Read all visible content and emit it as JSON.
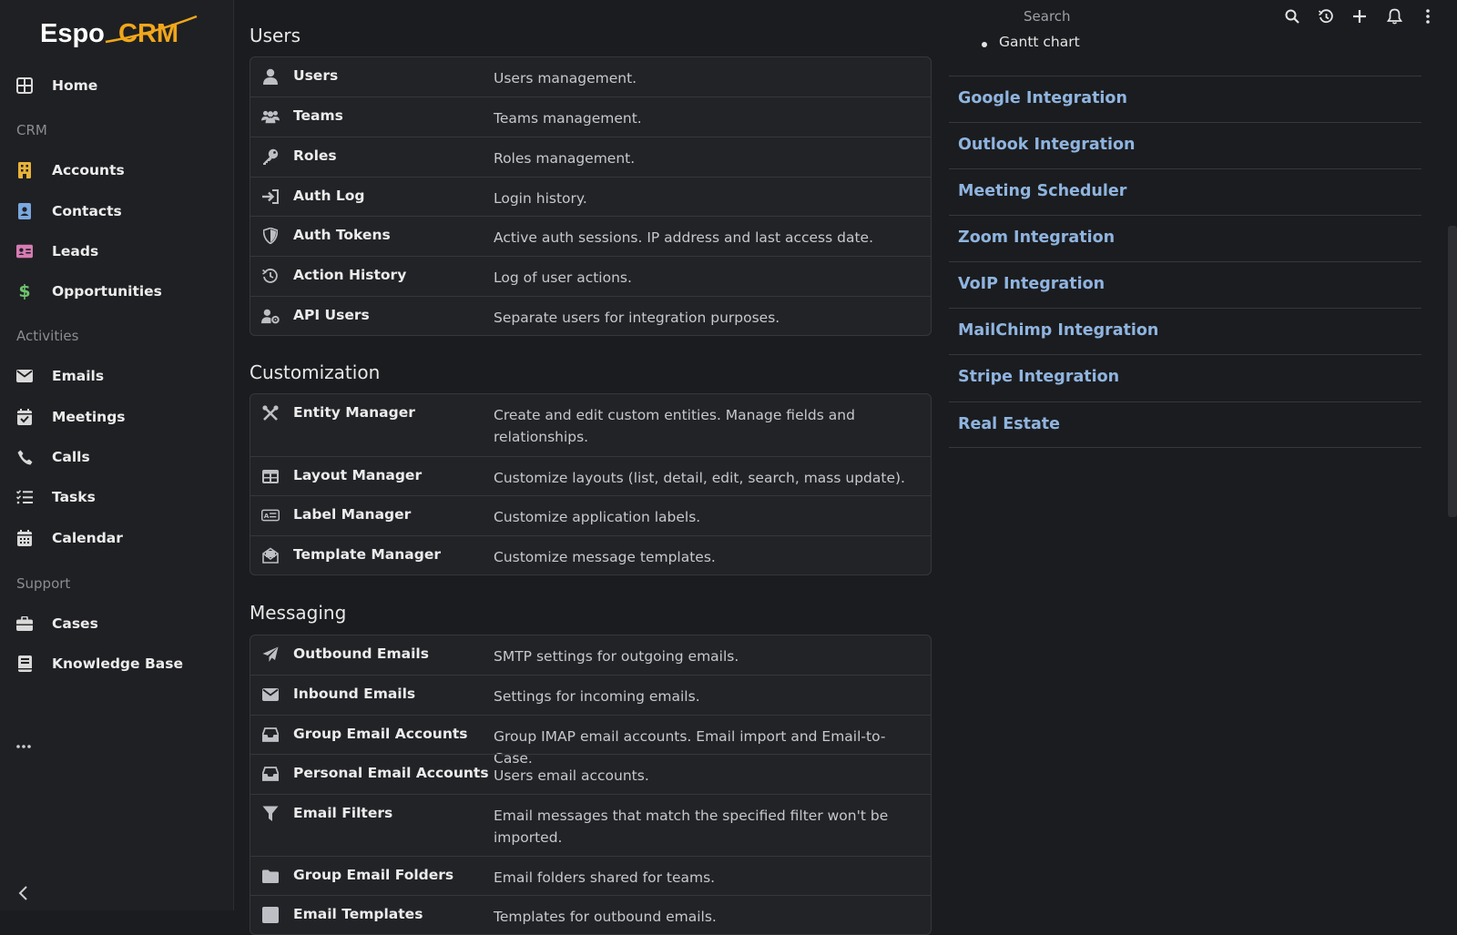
{
  "app": {
    "logo_text_espo": "Espo",
    "logo_text_crm": "CRM"
  },
  "sidebar": {
    "items": [
      {
        "label": "Home",
        "icon": "home-icon"
      },
      {
        "label": "Accounts",
        "icon": "building-icon",
        "color": "#e8b338"
      },
      {
        "label": "Contacts",
        "icon": "contact-card-icon",
        "color": "#7aa7e0"
      },
      {
        "label": "Leads",
        "icon": "id-card-icon",
        "color": "#d77bb4"
      },
      {
        "label": "Opportunities",
        "icon": "dollar-icon",
        "color": "#6dc46d"
      },
      {
        "label": "Emails",
        "icon": "envelope-icon"
      },
      {
        "label": "Meetings",
        "icon": "calendar-check-icon"
      },
      {
        "label": "Calls",
        "icon": "phone-icon"
      },
      {
        "label": "Tasks",
        "icon": "tasks-icon"
      },
      {
        "label": "Calendar",
        "icon": "calendar-icon"
      },
      {
        "label": "Cases",
        "icon": "briefcase-icon"
      },
      {
        "label": "Knowledge Base",
        "icon": "book-icon"
      }
    ],
    "sections": {
      "crm": "CRM",
      "activities": "Activities",
      "support": "Support"
    }
  },
  "topbar": {
    "search_placeholder": "Search"
  },
  "main": {
    "users_title": "Users",
    "users": [
      {
        "name": "Users",
        "desc": "Users management.",
        "icon": "user-icon"
      },
      {
        "name": "Teams",
        "desc": "Teams management.",
        "icon": "users-icon"
      },
      {
        "name": "Roles",
        "desc": "Roles management.",
        "icon": "key-icon"
      },
      {
        "name": "Auth Log",
        "desc": "Login history.",
        "icon": "sign-in-icon"
      },
      {
        "name": "Auth Tokens",
        "desc": "Active auth sessions. IP address and last access date.",
        "icon": "shield-icon"
      },
      {
        "name": "Action History",
        "desc": "Log of user actions.",
        "icon": "history-icon"
      },
      {
        "name": "API Users",
        "desc": "Separate users for integration purposes.",
        "icon": "user-cog-icon"
      }
    ],
    "customization_title": "Customization",
    "customization": [
      {
        "name": "Entity Manager",
        "desc": "Create and edit custom entities. Manage fields and relationships.",
        "icon": "tools-icon"
      },
      {
        "name": "Layout Manager",
        "desc": "Customize layouts (list, detail, edit, search, mass update).",
        "icon": "table-icon"
      },
      {
        "name": "Label Manager",
        "desc": "Customize application labels.",
        "icon": "label-icon"
      },
      {
        "name": "Template Manager",
        "desc": "Customize message templates.",
        "icon": "envelope-open-icon"
      }
    ],
    "messaging_title": "Messaging",
    "messaging": [
      {
        "name": "Outbound Emails",
        "desc": "SMTP settings for outgoing emails.",
        "icon": "paper-plane-icon"
      },
      {
        "name": "Inbound Emails",
        "desc": "Settings for incoming emails.",
        "icon": "envelope-icon"
      },
      {
        "name": "Group Email Accounts",
        "desc": "Group IMAP email accounts. Email import and Email-to-Case.",
        "icon": "inbox-icon"
      },
      {
        "name": "Personal Email Accounts",
        "desc": "Users email accounts.",
        "icon": "inbox-icon"
      },
      {
        "name": "Email Filters",
        "desc": "Email messages that match the specified filter won't be imported.",
        "icon": "filter-icon"
      },
      {
        "name": "Group Email Folders",
        "desc": "Email folders shared for teams.",
        "icon": "folder-icon"
      },
      {
        "name": "Email Templates",
        "desc": "Templates for outbound emails.",
        "icon": "envelope-square-icon"
      }
    ]
  },
  "right": {
    "gantt": "Gantt chart",
    "integrations": [
      "Google Integration",
      "Outlook Integration",
      "Meeting Scheduler",
      "Zoom Integration",
      "VoIP Integration",
      "MailChimp Integration",
      "Stripe Integration",
      "Real Estate"
    ]
  },
  "colors": {
    "link": "#8fb4df",
    "accent_logo": "#f0a71b"
  }
}
